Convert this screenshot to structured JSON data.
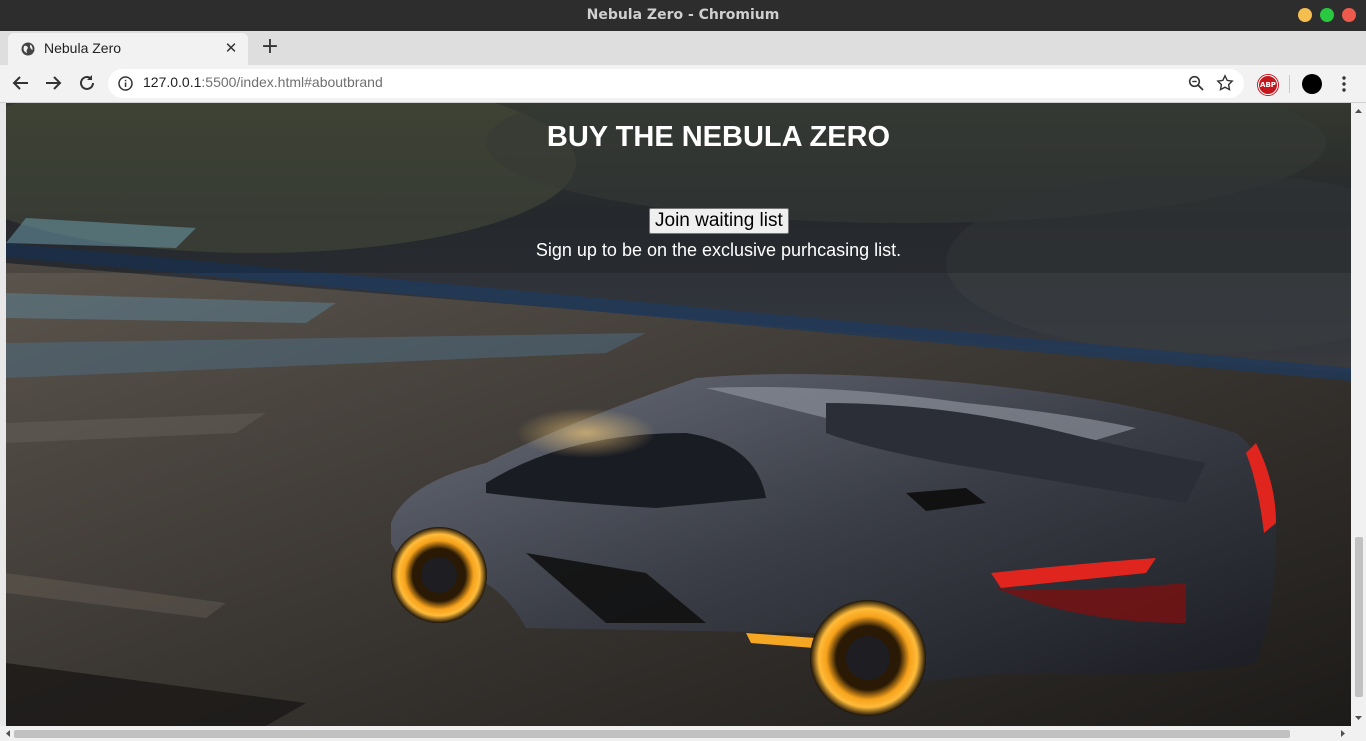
{
  "window": {
    "title": "Nebula Zero - Chromium"
  },
  "tab": {
    "title": "Nebula Zero"
  },
  "address_bar": {
    "host": "127.0.0.1",
    "rest": ":5500/index.html#aboutbrand"
  },
  "extensions": {
    "abp_label": "ABP"
  },
  "page": {
    "heading": "BUY THE NEBULA ZERO",
    "button_label": "Join waiting list",
    "subtext": "Sign up to be on the exclusive purhcasing list."
  },
  "colors": {
    "titlebar": "#2d2d2d",
    "accent_wheel": "#f5a623",
    "taillight": "#e0251e"
  }
}
